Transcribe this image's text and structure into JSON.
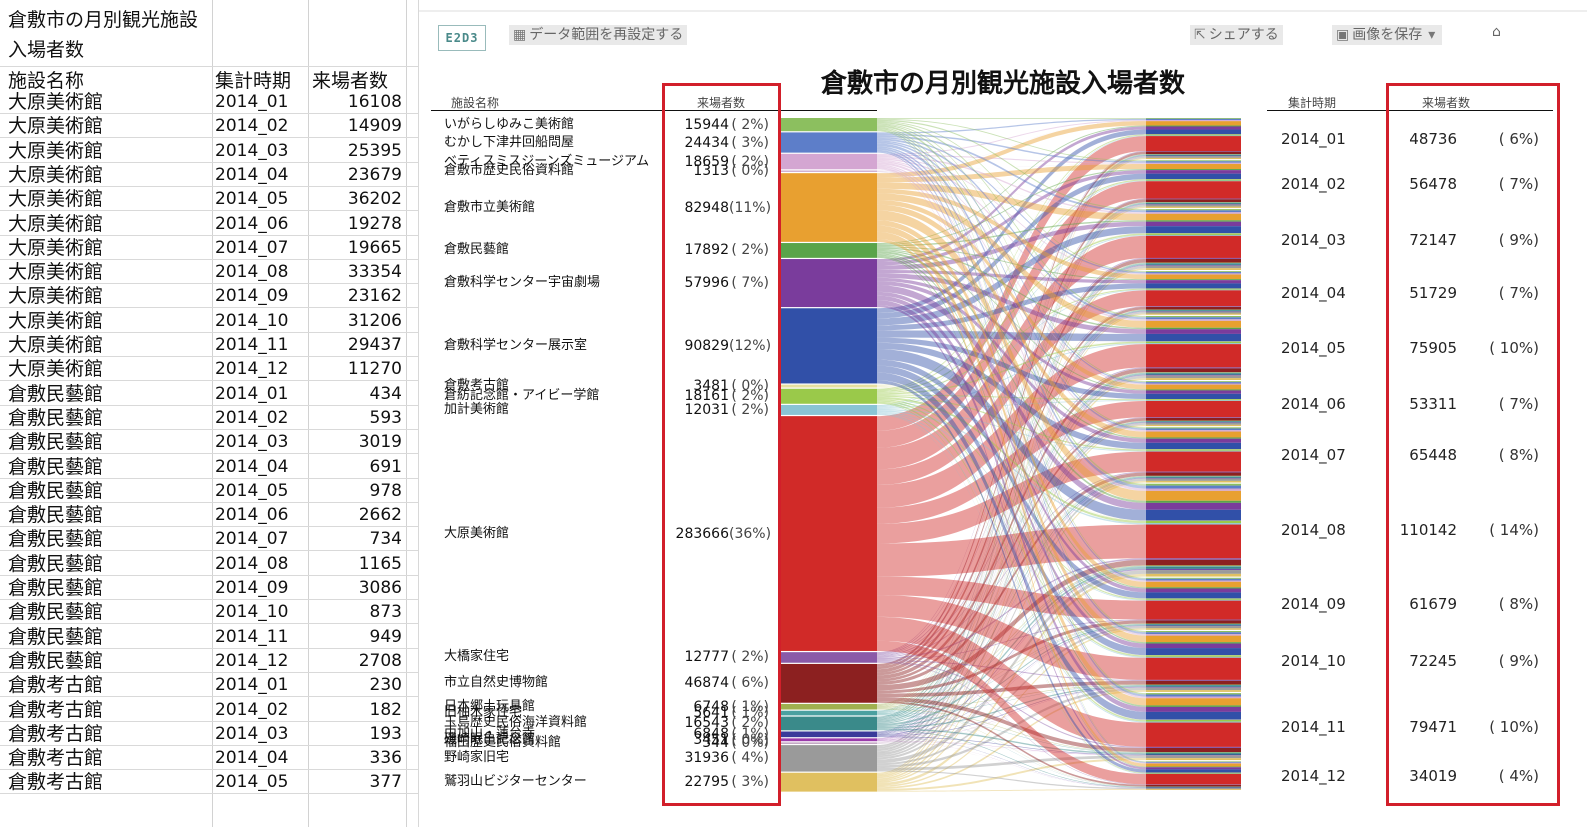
{
  "spreadsheet": {
    "title_line1": "倉敷市の月別観光施設",
    "title_line2": "入場者数",
    "headers": [
      "施設名称",
      "集計時期",
      "来場者数"
    ],
    "rows": [
      [
        "大原美術館",
        "2014_01",
        "16108"
      ],
      [
        "大原美術館",
        "2014_02",
        "14909"
      ],
      [
        "大原美術館",
        "2014_03",
        "25395"
      ],
      [
        "大原美術館",
        "2014_04",
        "23679"
      ],
      [
        "大原美術館",
        "2014_05",
        "36202"
      ],
      [
        "大原美術館",
        "2014_06",
        "19278"
      ],
      [
        "大原美術館",
        "2014_07",
        "19665"
      ],
      [
        "大原美術館",
        "2014_08",
        "33354"
      ],
      [
        "大原美術館",
        "2014_09",
        "23162"
      ],
      [
        "大原美術館",
        "2014_10",
        "31206"
      ],
      [
        "大原美術館",
        "2014_11",
        "29437"
      ],
      [
        "大原美術館",
        "2014_12",
        "11270"
      ],
      [
        "倉敷民藝館",
        "2014_01",
        "434"
      ],
      [
        "倉敷民藝館",
        "2014_02",
        "593"
      ],
      [
        "倉敷民藝館",
        "2014_03",
        "3019"
      ],
      [
        "倉敷民藝館",
        "2014_04",
        "691"
      ],
      [
        "倉敷民藝館",
        "2014_05",
        "978"
      ],
      [
        "倉敷民藝館",
        "2014_06",
        "2662"
      ],
      [
        "倉敷民藝館",
        "2014_07",
        "734"
      ],
      [
        "倉敷民藝館",
        "2014_08",
        "1165"
      ],
      [
        "倉敷民藝館",
        "2014_09",
        "3086"
      ],
      [
        "倉敷民藝館",
        "2014_10",
        "873"
      ],
      [
        "倉敷民藝館",
        "2014_11",
        "949"
      ],
      [
        "倉敷民藝館",
        "2014_12",
        "2708"
      ],
      [
        "倉敷考古館",
        "2014_01",
        "230"
      ],
      [
        "倉敷考古館",
        "2014_02",
        "182"
      ],
      [
        "倉敷考古館",
        "2014_03",
        "193"
      ],
      [
        "倉敷考古館",
        "2014_04",
        "336"
      ],
      [
        "倉敷考古館",
        "2014_05",
        "377"
      ]
    ]
  },
  "toolbar": {
    "logo": "E2D3",
    "reset_range_label": "データ範囲を再設定する",
    "share_label": "シェアする",
    "save_image_label": "画像を保存",
    "home_icon": "home-icon"
  },
  "chart_data": {
    "type": "parallel-sets",
    "title": "倉敷市の月別観光施設入場者数",
    "left_headers": [
      "施設名称",
      "来場者数"
    ],
    "right_headers": [
      "集計時期",
      "来場者数"
    ],
    "facilities": [
      {
        "name": "いがらしゆみこ美術館",
        "value": "15944",
        "pct": "( 2%)",
        "color": "#8cbf5f"
      },
      {
        "name": "むかし下津井回船問屋",
        "value": "24434",
        "pct": "( 3%)",
        "color": "#5d7ec9"
      },
      {
        "name": "ベティスミスジーンズミュージアム",
        "value": "18659",
        "pct": "( 2%)",
        "color": "#d4a6d2"
      },
      {
        "name": "倉敷市歴史民俗資料館",
        "value": "1313",
        "pct": "( 0%)",
        "color": "#d0b0d0"
      },
      {
        "name": "倉敷市立美術館",
        "value": "82948",
        "pct": "(11%)",
        "color": "#e8a030"
      },
      {
        "name": "倉敷民藝館",
        "value": "17892",
        "pct": "( 2%)",
        "color": "#5aa44a"
      },
      {
        "name": "倉敷科学センター宇宙劇場",
        "value": "57996",
        "pct": "( 7%)",
        "color": "#7a3c9c"
      },
      {
        "name": "倉敷科学センター展示室",
        "value": "90829",
        "pct": "(12%)",
        "color": "#3150a8"
      },
      {
        "name": "倉敷考古館",
        "value": "3481",
        "pct": "( 0%)",
        "color": "#e6e0a0"
      },
      {
        "name": "倉紡記念館・アイビー学館",
        "value": "18161",
        "pct": "( 2%)",
        "color": "#9ac94a"
      },
      {
        "name": "加計美術館",
        "value": "12031",
        "pct": "( 2%)",
        "color": "#8ac4d4"
      },
      {
        "name": "大原美術館",
        "value": "283666",
        "pct": "(36%)",
        "color": "#d12a28"
      },
      {
        "name": "大橋家住宅",
        "value": "12777",
        "pct": "( 2%)",
        "color": "#8a5aa8"
      },
      {
        "name": "市立自然史博物館",
        "value": "46874",
        "pct": "( 6%)",
        "color": "#8c2020"
      },
      {
        "name": "日本郷土玩具館",
        "value": "6748",
        "pct": "( 1%)",
        "color": "#a0b050"
      },
      {
        "name": "旧柚木家住宅",
        "value": "5641",
        "pct": "( 1%)",
        "color": "#4aa0a0"
      },
      {
        "name": "玉島歴史民俗海洋資料館",
        "value": "16543",
        "pct": "( 2%)",
        "color": "#3a8a8a"
      },
      {
        "name": "由加山・蓮台寺",
        "value": "6848",
        "pct": "( 1%)",
        "color": "#3a3a9a"
      },
      {
        "name": "磯崎眠亀記念館",
        "value": "3451",
        "pct": "( 0%)",
        "color": "#9a3aaa"
      },
      {
        "name": "福田歴史民俗資料館",
        "value": "344",
        "pct": "( 0%)",
        "color": "#c0a0c0"
      },
      {
        "name": "野崎家旧宅",
        "value": "31936",
        "pct": "( 4%)",
        "color": "#9a9a9a"
      },
      {
        "name": "鷲羽山ビジターセンター",
        "value": "22795",
        "pct": "( 3%)",
        "color": "#e0c060"
      }
    ],
    "periods": [
      {
        "name": "2014_01",
        "value": "48736",
        "pct": "( 6%)"
      },
      {
        "name": "2014_02",
        "value": "56478",
        "pct": "( 7%)"
      },
      {
        "name": "2014_03",
        "value": "72147",
        "pct": "( 9%)"
      },
      {
        "name": "2014_04",
        "value": "51729",
        "pct": "( 7%)"
      },
      {
        "name": "2014_05",
        "value": "75905",
        "pct": "( 10%)"
      },
      {
        "name": "2014_06",
        "value": "53311",
        "pct": "( 7%)"
      },
      {
        "name": "2014_07",
        "value": "65448",
        "pct": "( 8%)"
      },
      {
        "name": "2014_08",
        "value": "110142",
        "pct": "( 14%)"
      },
      {
        "name": "2014_09",
        "value": "61679",
        "pct": "( 8%)"
      },
      {
        "name": "2014_10",
        "value": "72245",
        "pct": "( 9%)"
      },
      {
        "name": "2014_11",
        "value": "79471",
        "pct": "( 10%)"
      },
      {
        "name": "2014_12",
        "value": "34019",
        "pct": "( 4%)"
      }
    ]
  }
}
